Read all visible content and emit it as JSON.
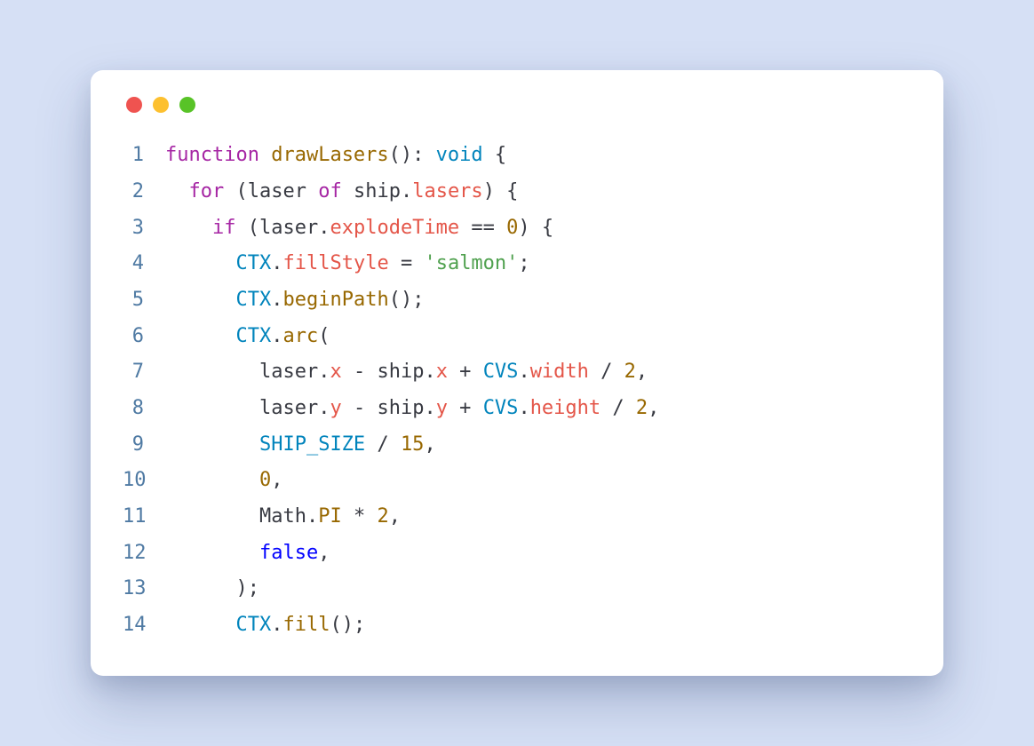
{
  "traffic": {
    "red": "#ef5350",
    "yellow": "#fdc02f",
    "green": "#58c327"
  },
  "code": {
    "line_count": 14,
    "l1": {
      "n": "1",
      "kw_function": "function",
      "fn_name": "drawLasers",
      "parens": "()",
      "colon": ": ",
      "type": "void",
      "brace": " {"
    },
    "l2": {
      "n": "2",
      "indent": "  ",
      "kw_for": "for",
      "open": " (",
      "var": "laser",
      "kw_of": " of ",
      "obj": "ship",
      "dot": ".",
      "prop": "lasers",
      "close": ") {"
    },
    "l3": {
      "n": "3",
      "indent": "    ",
      "kw_if": "if",
      "open": " (",
      "obj": "laser",
      "dot": ".",
      "prop": "explodeTime",
      "op": " == ",
      "num": "0",
      "close": ") {"
    },
    "l4": {
      "n": "4",
      "indent": "      ",
      "obj": "CTX",
      "dot": ".",
      "prop": "fillStyle",
      "eq": " = ",
      "str": "'salmon'",
      "semi": ";"
    },
    "l5": {
      "n": "5",
      "indent": "      ",
      "obj": "CTX",
      "dot": ".",
      "fn": "beginPath",
      "call": "();"
    },
    "l6": {
      "n": "6",
      "indent": "      ",
      "obj": "CTX",
      "dot": ".",
      "fn": "arc",
      "open": "("
    },
    "l7": {
      "n": "7",
      "indent": "        ",
      "a": "laser",
      "ad": ".",
      "ap": "x",
      "m": " - ",
      "b": "ship",
      "bd": ".",
      "bp": "x",
      "p": " + ",
      "c": "CVS",
      "cd": ".",
      "cp": "width",
      "d": " / ",
      "num": "2",
      "comma": ","
    },
    "l8": {
      "n": "8",
      "indent": "        ",
      "a": "laser",
      "ad": ".",
      "ap": "y",
      "m": " - ",
      "b": "ship",
      "bd": ".",
      "bp": "y",
      "p": " + ",
      "c": "CVS",
      "cd": ".",
      "cp": "height",
      "d": " / ",
      "num": "2",
      "comma": ","
    },
    "l9": {
      "n": "9",
      "indent": "        ",
      "id": "SHIP_SIZE",
      "op": " / ",
      "num": "15",
      "comma": ","
    },
    "l10": {
      "n": "10",
      "indent": "        ",
      "num": "0",
      "comma": ","
    },
    "l11": {
      "n": "11",
      "indent": "        ",
      "obj": "Math",
      "dot": ".",
      "prop": "PI",
      "op": " * ",
      "num": "2",
      "comma": ","
    },
    "l12": {
      "n": "12",
      "indent": "        ",
      "bool": "false",
      "comma": ","
    },
    "l13": {
      "n": "13",
      "indent": "      ",
      "close": ");"
    },
    "l14": {
      "n": "14",
      "indent": "      ",
      "obj": "CTX",
      "dot": ".",
      "fn": "fill",
      "call": "();"
    }
  }
}
